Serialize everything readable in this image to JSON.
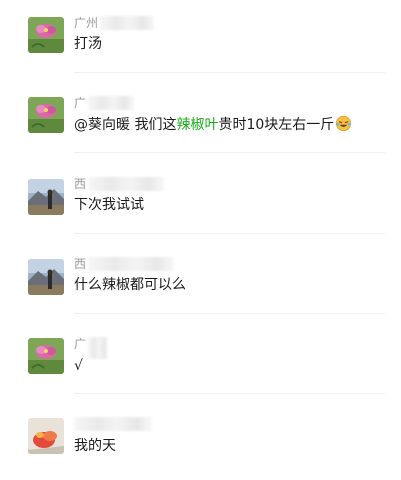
{
  "messages": [
    {
      "avatar": "flower-avatar",
      "name_visible": "广州",
      "text": "打汤"
    },
    {
      "avatar": "flower-avatar",
      "name_visible": "广",
      "mention": "@葵向暖",
      "text_pre": " 我们这",
      "highlight": "辣椒叶",
      "text_post": "贵时10块左右一斤",
      "emoji": "laughing-tears-icon"
    },
    {
      "avatar": "mountain-avatar",
      "name_visible": "西",
      "text": "下次我试试"
    },
    {
      "avatar": "mountain-avatar",
      "name_visible": "西",
      "text": "什么辣椒都可以么"
    },
    {
      "avatar": "flower-avatar",
      "name_visible": "广",
      "text": "√"
    },
    {
      "avatar": "fruit-avatar",
      "name_visible": "",
      "text": "我的天"
    }
  ],
  "colors": {
    "link": "#1aad19",
    "name": "#9b9b9b",
    "text": "#1a1a1a",
    "divider": "#efefef"
  }
}
